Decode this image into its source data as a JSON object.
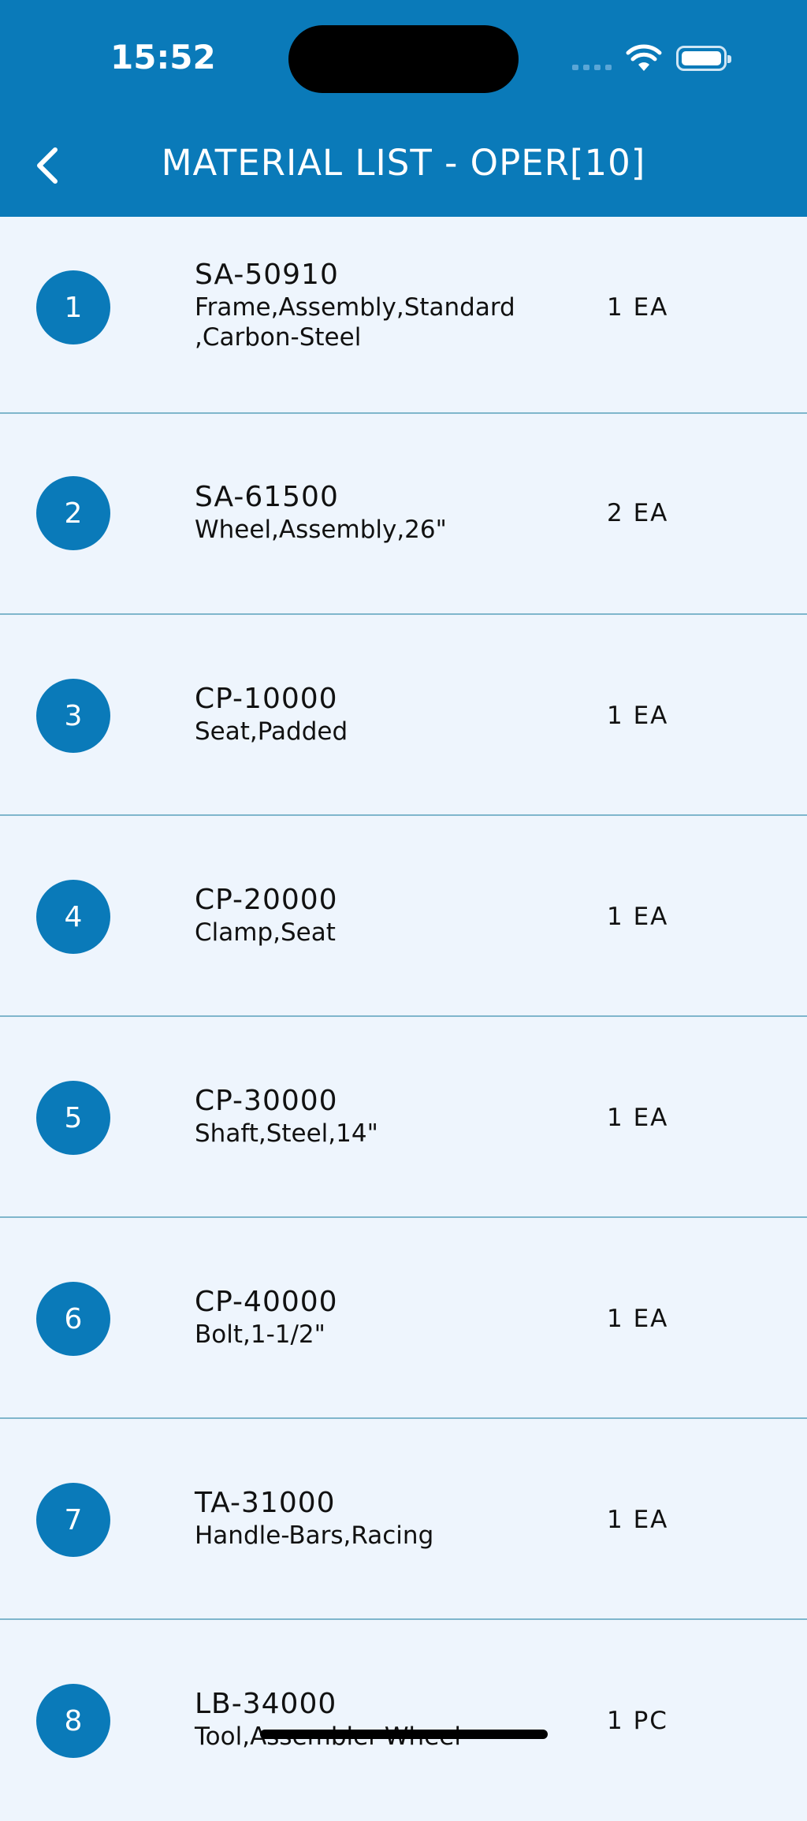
{
  "status_bar": {
    "time": "15:52"
  },
  "header": {
    "title": "MATERIAL LIST - OPER[10]"
  },
  "items": [
    {
      "num": "1",
      "code": "SA-50910",
      "desc": "Frame,Assembly,Standard\n,Carbon-Steel",
      "qty": "1 EA"
    },
    {
      "num": "2",
      "code": "SA-61500",
      "desc": "Wheel,Assembly,26\"",
      "qty": "2 EA"
    },
    {
      "num": "3",
      "code": "CP-10000",
      "desc": "Seat,Padded",
      "qty": "1 EA"
    },
    {
      "num": "4",
      "code": "CP-20000",
      "desc": "Clamp,Seat",
      "qty": "1 EA"
    },
    {
      "num": "5",
      "code": "CP-30000",
      "desc": "Shaft,Steel,14\"",
      "qty": "1 EA"
    },
    {
      "num": "6",
      "code": "CP-40000",
      "desc": "Bolt,1-1/2\"",
      "qty": "1 EA"
    },
    {
      "num": "7",
      "code": "TA-31000",
      "desc": "Handle-Bars,Racing",
      "qty": "1 EA"
    },
    {
      "num": "8",
      "code": "LB-34000",
      "desc": "Tool,Assembler-Wheel",
      "qty": "1 PC"
    }
  ],
  "colors": {
    "accent": "#0a7ab9",
    "background": "#eef5fd",
    "divider": "#7fb6cc"
  }
}
